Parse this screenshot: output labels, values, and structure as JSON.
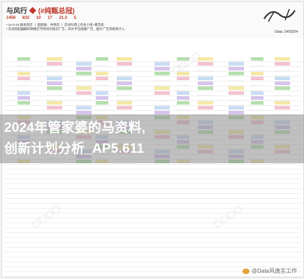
{
  "header": {
    "title_prefix": "与风行",
    "title_badge": "(#纯甄总冠)",
    "stats": [
      {
        "value": "1456"
      },
      {
        "value": "832"
      },
      {
        "value": "10"
      },
      {
        "value": "17"
      },
      {
        "value": "21.3"
      },
      {
        "value": "5"
      }
    ],
    "notes": [
      "• 24-3-18  群发到店 丨 超能群，共更新  丨 恋间叫博上有名小组+看苏如",
      "• 在线到超蹦麟的精椿芒宇所同的视识广告，四大平台随顺广告，酷片广告等看来计入"
    ],
    "date": "Data: 24/03/24"
  },
  "overlay": {
    "line1": "2024年管家婆的马资料,",
    "line2": "创新计划分析_AP5.611"
  },
  "weibo": {
    "label": "@Data风逸言工作"
  },
  "colors": {
    "green": "#b7dfb0",
    "pink": "#f4c2cf",
    "purple": "#d6c4ec",
    "yellow": "#f6e9a6",
    "blue": "#c9dcf5",
    "red": "#c0392b"
  }
}
